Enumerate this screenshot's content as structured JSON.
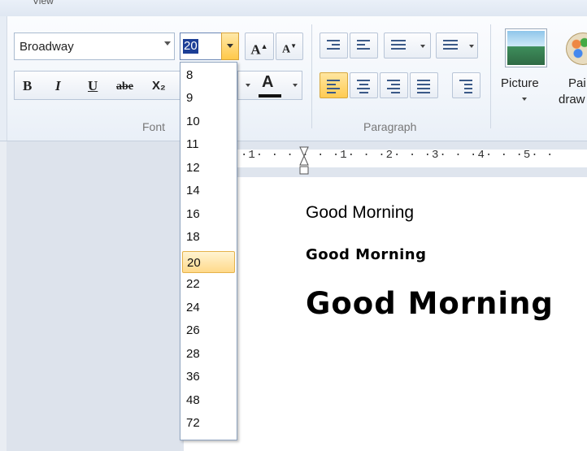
{
  "tabs": {
    "view_label": "View"
  },
  "font_group": {
    "font_name": "Broadway",
    "font_size": "20",
    "grow_label": "A",
    "shrink_label": "A",
    "bold_label": "B",
    "italic_label": "I",
    "underline_label": "U",
    "strike_label": "abe",
    "subscript_label": "X₂",
    "font_color_label": "A",
    "group_label": "Font"
  },
  "paragraph_group": {
    "group_label": "Paragraph"
  },
  "insert_group": {
    "picture_label": "Picture",
    "paint_label_line1": "Pai",
    "paint_label_line2": "draw"
  },
  "ruler": {
    "text": "·1· · ·  · · ·1· · ·2· · ·3· · ·4· · ·5· ·"
  },
  "document": {
    "lines": [
      "Good Morning",
      "Good Morning",
      "Good Morning"
    ]
  },
  "font_size_dropdown": {
    "options": [
      "8",
      "9",
      "10",
      "11",
      "12",
      "14",
      "16",
      "18",
      "20",
      "22",
      "24",
      "26",
      "28",
      "36",
      "48",
      "72"
    ],
    "selected": "20"
  },
  "colors": {
    "selection_highlight": "#ffd98a",
    "size_box_selection": "#1d3f96"
  }
}
